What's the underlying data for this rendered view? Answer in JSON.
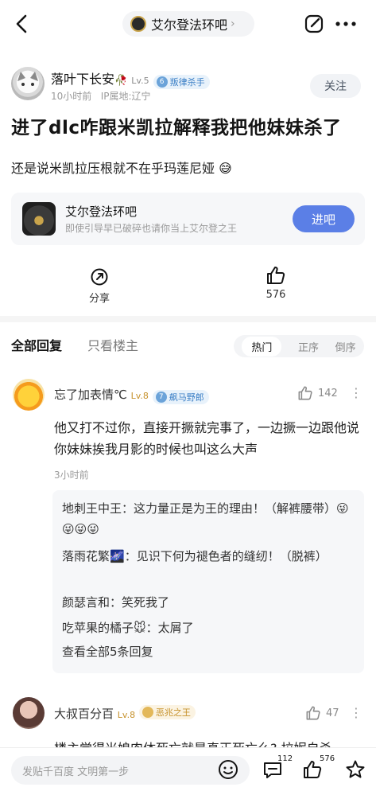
{
  "nav": {
    "forum_name": "艾尔登法环吧",
    "chevron": "›",
    "more": "···"
  },
  "author": {
    "name": "落叶下长安",
    "name_emoji": "🥀",
    "level": "Lv.5",
    "tag_level": "6",
    "tag": "叛律杀手",
    "time": "10小时前",
    "ip": "IP属地:辽宁",
    "follow": "关注"
  },
  "post": {
    "title": "进了dlc咋跟米凯拉解释我把他妹妹杀了",
    "body": "还是说米凯拉压根就不在乎玛莲尼娅",
    "body_emoji": "😅"
  },
  "forum_card": {
    "name": "艾尔登法环吧",
    "subtitle": "即使引导早已破碎也请你当上艾尔登之王",
    "join": "进吧"
  },
  "actions": {
    "share": "分享",
    "likes": "576"
  },
  "tabs": {
    "all": "全部回复",
    "op_only": "只看楼主",
    "sort": [
      "热门",
      "正序",
      "倒序"
    ]
  },
  "comment1": {
    "name": "忘了加表情℃",
    "level": "Lv.8",
    "tag_level": "7",
    "tag": "飙马野郎",
    "likes": "142",
    "text": "他又打不过你，直接开撅就完事了，一边撅一边跟他说你妹妹挨我月影的时候也叫这么大声",
    "time": "3小时前",
    "replies": [
      {
        "who": "地刺王中王",
        "text": "：这力量正是为王的理由！（解裤腰带）😜😜😜😜"
      },
      {
        "who": "落雨花繁🌌",
        "text": "：见识下何为褪色者的缝纫！（脱裤）"
      },
      {
        "who": "颜瑟言和",
        "text": "：笑死我了"
      },
      {
        "who": "吃苹果的橘子🐭",
        "text": "：太屑了"
      }
    ],
    "view_all": "查看全部5条回复"
  },
  "comment2": {
    "name": "大叔百分百",
    "level": "Lv.8",
    "tag": "恶兆之王",
    "likes": "47",
    "text_partial": "楼主觉得米娘肉体死亡就是真正死亡么? 拉妮自杀"
  },
  "bottom": {
    "placeholder": "发贴千百度 文明第一步",
    "comments": "112",
    "likes": "576"
  },
  "colors": {
    "accent": "#5b7fe6",
    "tag_blue": "#3b7fc6",
    "tag_gold": "#c6912b"
  }
}
